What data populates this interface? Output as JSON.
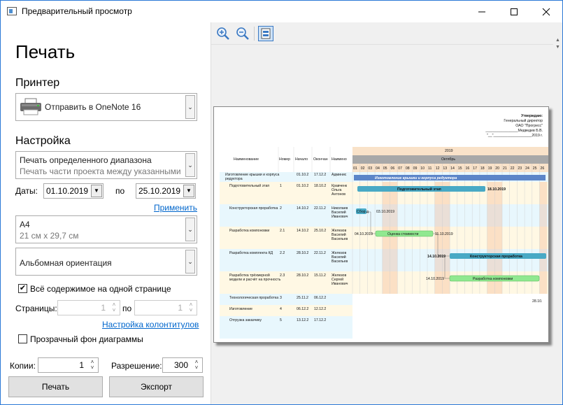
{
  "window": {
    "title": "Предварительный просмотр"
  },
  "panel": {
    "heading": "Печать",
    "printer_label": "Принтер",
    "printer_value": "Отправить в OneNote 16",
    "settings_label": "Настройка",
    "range_title": "Печать определенного диапазона",
    "range_sub": "Печать части проекта между указанными",
    "dates_label": "Даты:",
    "date_from": "01.10.2019",
    "to_label": "по",
    "date_to": "25.10.2019",
    "apply_link": "Применить",
    "paper_title": "A4",
    "paper_sub": "21 см x 29,7 см",
    "orientation": "Альбомная ориентация",
    "fit_checked": "✔",
    "fit_label": "Всё содержимое на одной странице",
    "pages_label": "Страницы:",
    "page_from": "1",
    "page_to_label": "по",
    "page_to": "1",
    "header_link": "Настройка колонтитулов",
    "transparent_label": "Прозрачный фон диаграммы",
    "copies_label": "Копии:",
    "copies": "1",
    "resolution_label": "Разрешение:",
    "resolution": "300",
    "print_button": "Печать",
    "export_button": "Экспорт"
  },
  "preview": {
    "approve": "Утверждаю:",
    "approve_l2": "Генеральный директор",
    "approve_l3": "ОАО \"Прогресс\"",
    "approve_l4": "________________Медведев Б.В.",
    "approve_l5": "\"__\"___________________2019 г.",
    "col_name": "Наименование",
    "col_num": "Номер",
    "col_start": "Начало",
    "col_end": "Окончан",
    "col_res": "Наимено",
    "year": "2019",
    "month": "Октябрь",
    "days": [
      "01",
      "02",
      "03",
      "04",
      "05",
      "06",
      "07",
      "08",
      "09",
      "10",
      "11",
      "12",
      "13",
      "14",
      "15",
      "16",
      "17",
      "18",
      "19",
      "20",
      "21",
      "22",
      "23",
      "24",
      "25",
      "26"
    ],
    "rows": [
      {
        "name": "Изготовление крышки и корпуса редуктора",
        "num": "",
        "start": "01.10.2",
        "end": "17.12.2",
        "res": "Админис"
      },
      {
        "name": "Подготовительный этап",
        "num": "1",
        "start": "01.10.2",
        "end": "18.10.2",
        "res": "Кравченк Ольга Антонов"
      },
      {
        "name": "Конструкторская проработка",
        "num": "2",
        "start": "14.10.2",
        "end": "22.11.2",
        "res": "Николаев Василий Иванович"
      },
      {
        "name": "Разработка компоновки",
        "num": "2.1",
        "start": "14.10.2",
        "end": "25.10.2",
        "res": "Железов Василий Васильев"
      },
      {
        "name": "Разработка комплекта КД",
        "num": "2.2",
        "start": "28.10.2",
        "end": "22.11.2",
        "res": "Железов Василий Васильев"
      },
      {
        "name": "Разработка трёхмерной модели и расчёт на прочность",
        "num": "2.3",
        "start": "28.10.2",
        "end": "15.11.2",
        "res": "Железов Сергей Иванович"
      },
      {
        "name": "Технологическая проработка",
        "num": "3",
        "start": "25.11.2",
        "end": "06.12.2",
        "res": ""
      },
      {
        "name": "Изготовление",
        "num": "4",
        "start": "06.12.2",
        "end": "12.12.2",
        "res": ""
      },
      {
        "name": "Отгрузка заказчику",
        "num": "5",
        "start": "13.12.2",
        "end": "17.12.2",
        "res": ""
      }
    ],
    "bars": {
      "summary": "Изготовление крышки и корпуса редуктора",
      "prep": "Подготовительный этап",
      "prep_end": "18.10.2019",
      "gather": "Сбор д",
      "gather_date": "03.10.2019",
      "estimate": "Оценка стоимости",
      "estimate_start": "04.10.2019",
      "estimate_end": "11.10.2019",
      "design": "Конструкторская проработка",
      "design_start": "14.10.2019",
      "layout": "Разработка компоновки",
      "layout_start": "14.10.2019",
      "tail": "28.10."
    }
  },
  "colors": {
    "accent": "#2b78d6",
    "summary_bar": "#5c85c8",
    "task_bar": "#48a9c5",
    "milestone_bar": "#90e890"
  }
}
